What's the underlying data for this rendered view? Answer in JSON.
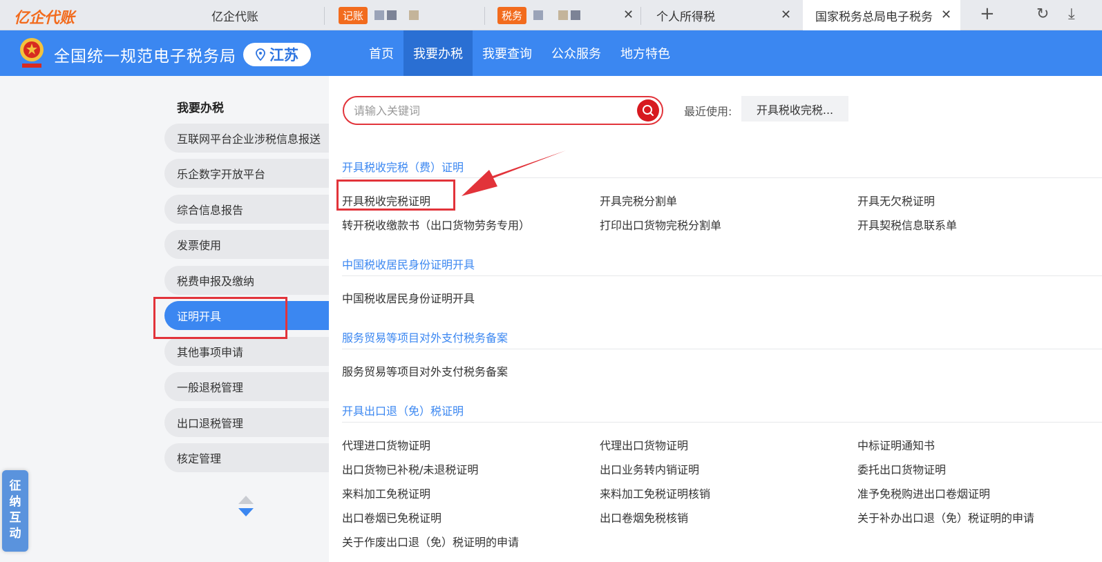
{
  "browser": {
    "brand": "亿企代账",
    "tabs": [
      {
        "label": "亿企代账"
      },
      {
        "badge": "记账"
      },
      {
        "badge": "税务"
      },
      {
        "label": "个人所得税"
      },
      {
        "label": "国家税务总局电子税务"
      }
    ],
    "new_tab_glyph": "+",
    "close_glyph": "✕",
    "reload_glyph": "↻",
    "download_glyph": "⤓"
  },
  "header": {
    "site_title": "全国统一规范电子税务局",
    "region": "江苏",
    "nav": [
      "首页",
      "我要办税",
      "我要查询",
      "公众服务",
      "地方特色"
    ],
    "active_nav": 1
  },
  "sidebar": {
    "title": "我要办税",
    "items": [
      {
        "label": "互联网平台企业涉税信息报送"
      },
      {
        "label": "乐企数字开放平台"
      },
      {
        "label": "综合信息报告"
      },
      {
        "label": "发票使用"
      },
      {
        "label": "税费申报及缴纳"
      },
      {
        "label": "证明开具",
        "active": true
      },
      {
        "label": "其他事项申请"
      },
      {
        "label": "一般退税管理"
      },
      {
        "label": "出口退税管理"
      },
      {
        "label": "核定管理"
      }
    ],
    "float_tab": [
      "征",
      "纳",
      "互",
      "动"
    ]
  },
  "search": {
    "placeholder": "请输入关键词",
    "value": "",
    "recent_label": "最近使用:",
    "recent_item": "开具税收完税..."
  },
  "sections": [
    {
      "title": "开具税收完税（费）证明",
      "items": [
        "开具税收完税证明",
        "开具完税分割单",
        "开具无欠税证明",
        "转开税收缴款书（出口货物劳务专用）",
        "打印出口货物完税分割单",
        "开具契税信息联系单"
      ]
    },
    {
      "title": "中国税收居民身份证明开具",
      "items": [
        "中国税收居民身份证明开具"
      ]
    },
    {
      "title": "服务贸易等项目对外支付税务备案",
      "items": [
        "服务贸易等项目对外支付税务备案"
      ]
    },
    {
      "title": "开具出口退（免）税证明",
      "items": [
        "代理进口货物证明",
        "代理出口货物证明",
        "中标证明通知书",
        "出口货物已补税/未退税证明",
        "出口业务转内销证明",
        "委托出口货物证明",
        "来料加工免税证明",
        "来料加工免税证明核销",
        "准予免税购进出口卷烟证明",
        "出口卷烟已免税证明",
        "出口卷烟免税核销",
        "关于补办出口退（免）税证明的申请",
        "关于作废出口退（免）税证明的申请"
      ]
    }
  ],
  "colors": {
    "brand_blue": "#3b87f1",
    "highlight_red": "#e2333a",
    "brand_orange": "#f26b1d"
  }
}
